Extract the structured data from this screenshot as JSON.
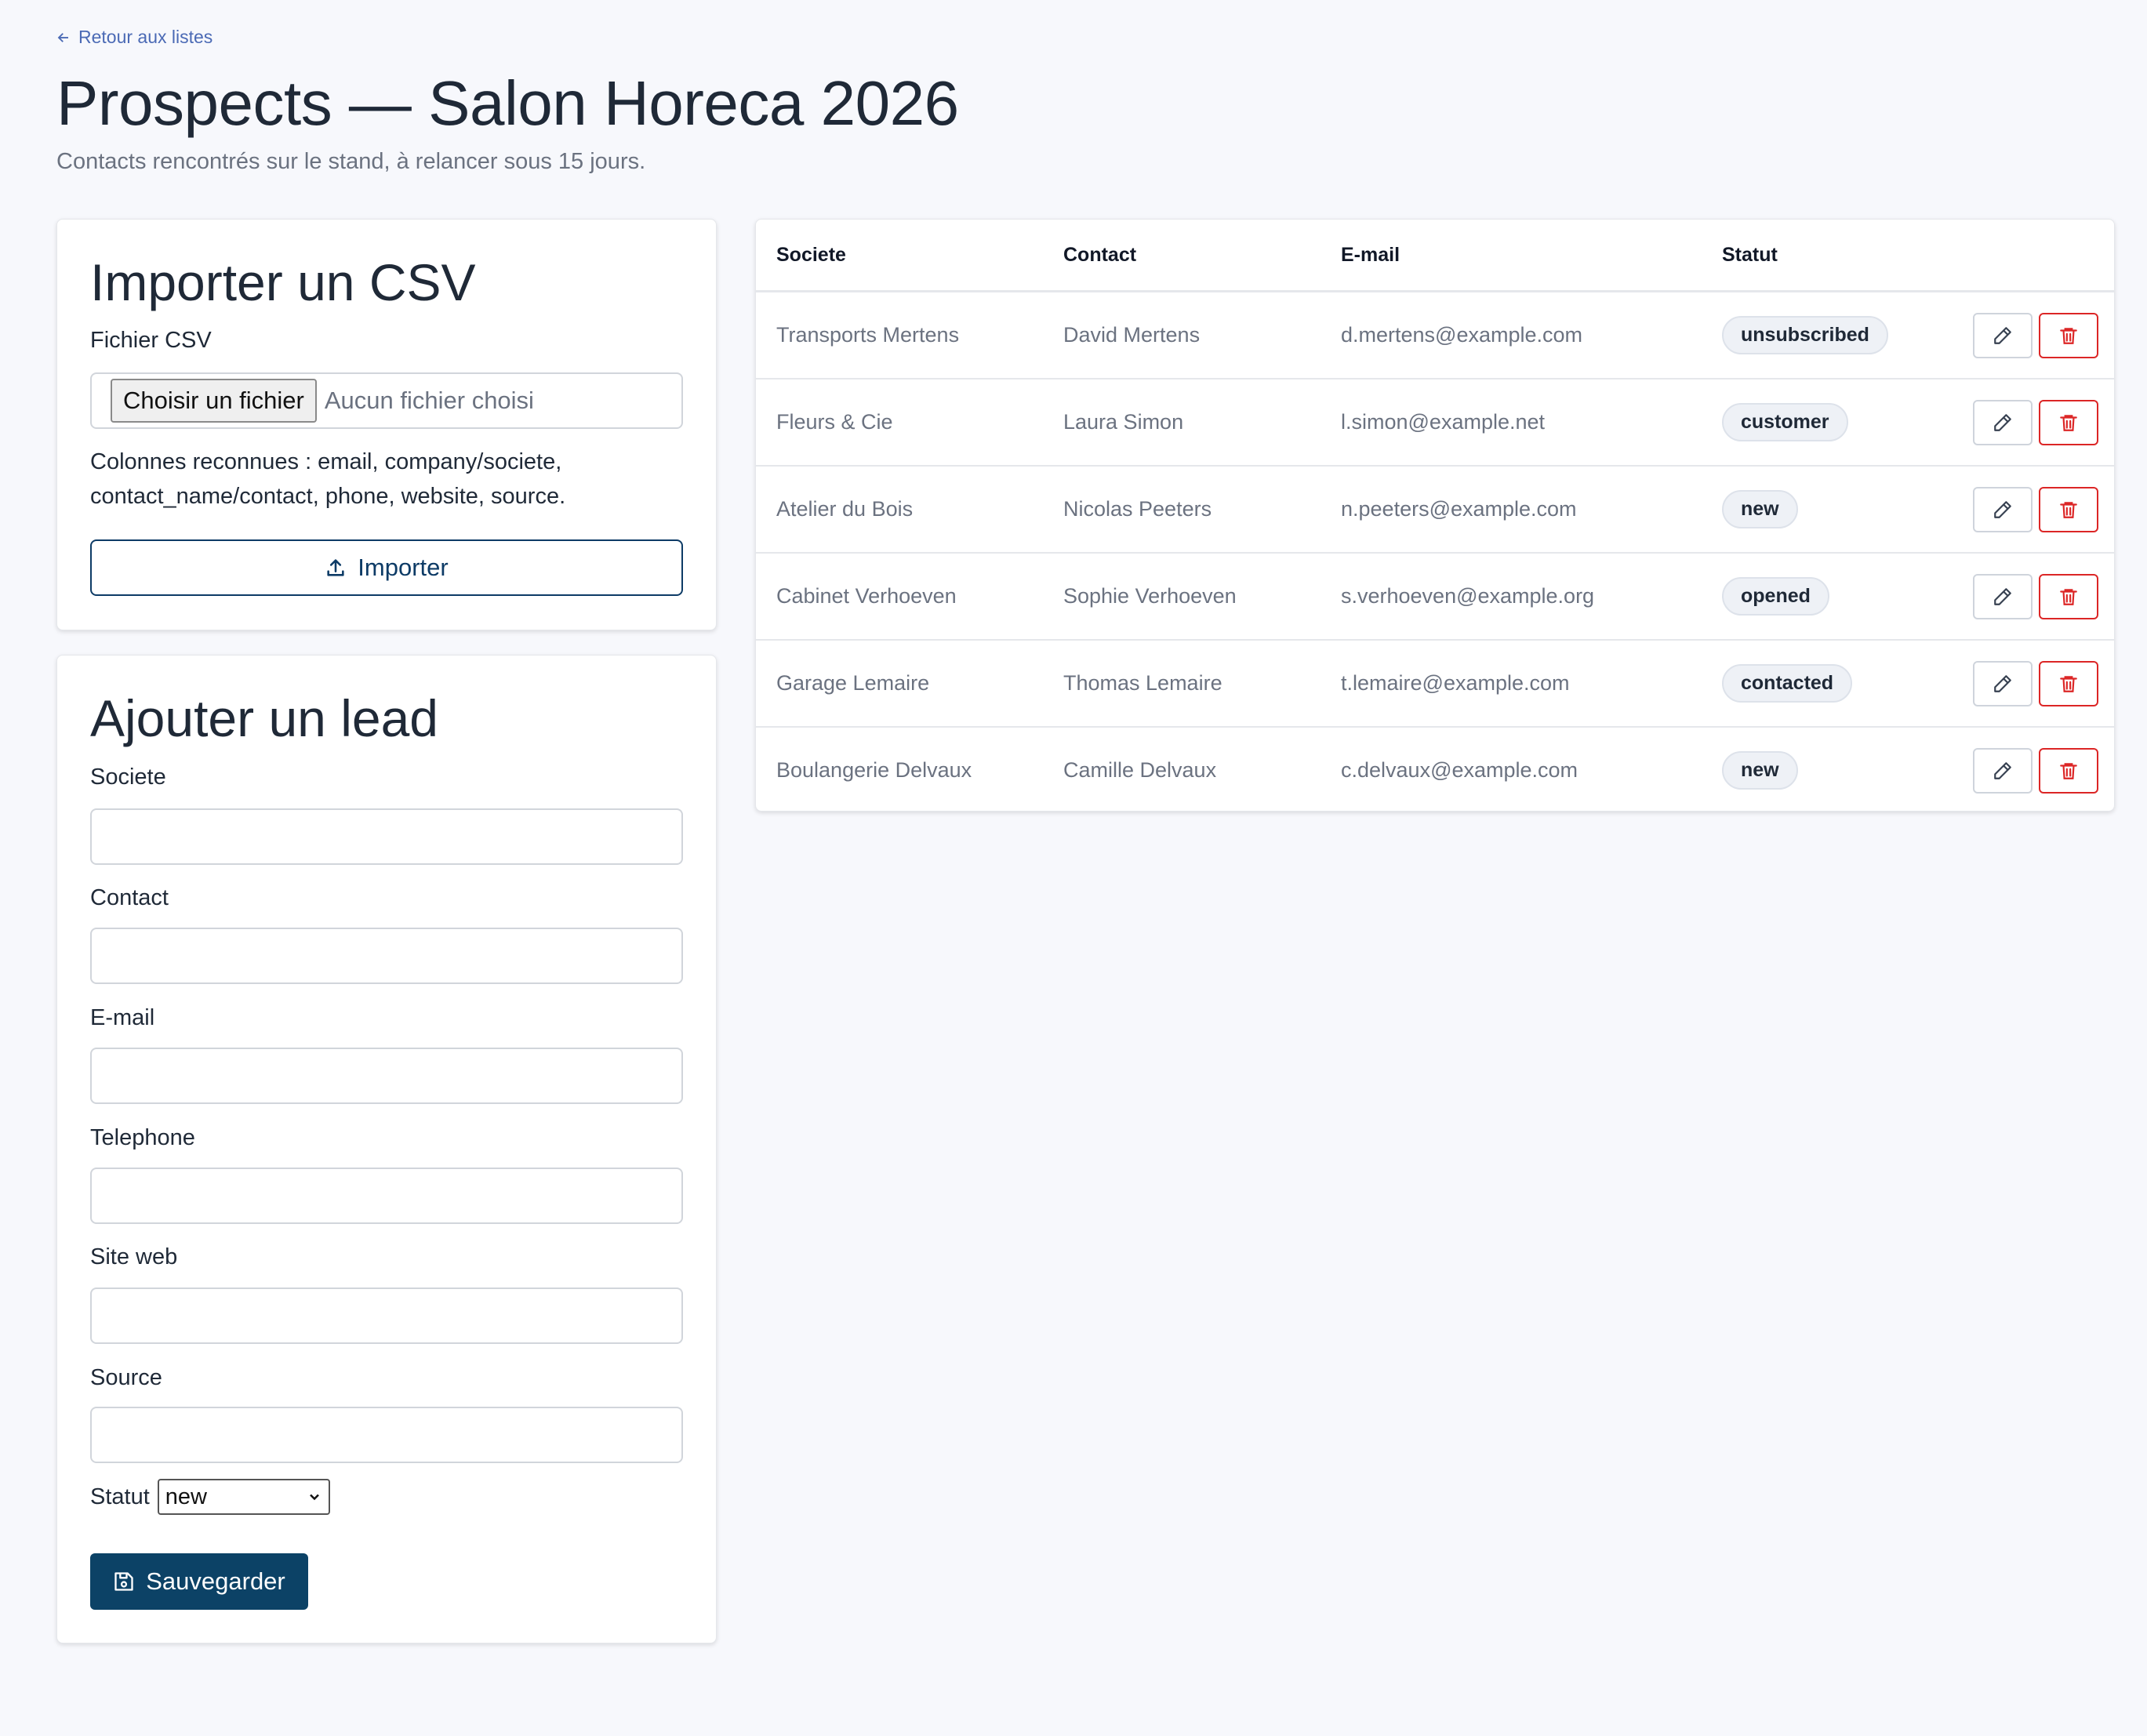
{
  "back_link": "Retour aux listes",
  "title": "Prospects — Salon Horeca 2026",
  "subtitle": "Contacts rencontrés sur le stand, à relancer sous 15 jours.",
  "import_card": {
    "title": "Importer un CSV",
    "file_label": "Fichier CSV",
    "choose_button": "Choisir un fichier",
    "no_file": "Aucun fichier choisi",
    "help": "Colonnes reconnues : email, company/societe, contact_name/contact, phone, website, source.",
    "import_button": "Importer"
  },
  "lead_card": {
    "title": "Ajouter un lead",
    "fields": [
      {
        "label": "Societe",
        "value": ""
      },
      {
        "label": "Contact",
        "value": ""
      },
      {
        "label": "E-mail",
        "value": ""
      },
      {
        "label": "Telephone",
        "value": ""
      },
      {
        "label": "Site web",
        "value": ""
      },
      {
        "label": "Source",
        "value": ""
      }
    ],
    "status_label": "Statut",
    "status_value": "new",
    "save_button": "Sauvegarder"
  },
  "table": {
    "headers": [
      "Societe",
      "Contact",
      "E-mail",
      "Statut"
    ],
    "rows": [
      {
        "company": "Transports Mertens",
        "contact": "David Mertens",
        "email": "d.mertens@example.com",
        "status": "unsubscribed"
      },
      {
        "company": "Fleurs & Cie",
        "contact": "Laura Simon",
        "email": "l.simon@example.net",
        "status": "customer"
      },
      {
        "company": "Atelier du Bois",
        "contact": "Nicolas Peeters",
        "email": "n.peeters@example.com",
        "status": "new"
      },
      {
        "company": "Cabinet Verhoeven",
        "contact": "Sophie Verhoeven",
        "email": "s.verhoeven@example.org",
        "status": "opened"
      },
      {
        "company": "Garage Lemaire",
        "contact": "Thomas Lemaire",
        "email": "t.lemaire@example.com",
        "status": "contacted"
      },
      {
        "company": "Boulangerie Delvaux",
        "contact": "Camille Delvaux",
        "email": "c.delvaux@example.com",
        "status": "new"
      }
    ]
  },
  "colors": {
    "primary": "#0c4266",
    "danger": "#dc2626",
    "link": "#4b6ab5",
    "background": "#f7f8fc"
  }
}
